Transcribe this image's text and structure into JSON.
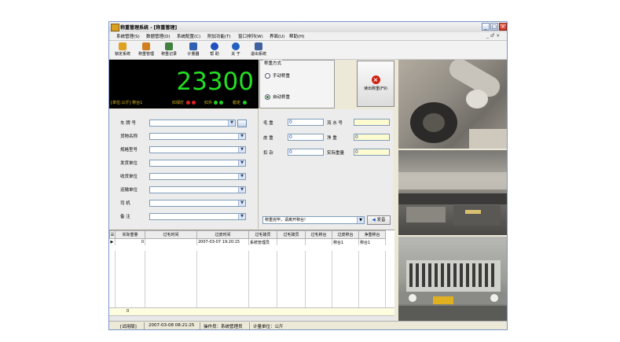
{
  "window": {
    "title": "称重管理系统 - [称重管理]",
    "controls": {
      "minimize": "_",
      "maximize": "□",
      "close": "×"
    }
  },
  "menu": {
    "items": [
      "系统管理(S)",
      "数据管理(D)",
      "系统配置(C)",
      "附加功能(T)",
      "窗口排列(W)",
      "界面(U)",
      "帮助(H)"
    ],
    "mdi_controls": "_ ♂ ×"
  },
  "toolbar": {
    "buttons": [
      {
        "label": "锁定系统",
        "icon": "lock-icon",
        "color": "#e0a020"
      },
      {
        "label": "称重管理",
        "icon": "scale-icon",
        "color": "#d08020"
      },
      {
        "label": "称重记录",
        "icon": "records-icon",
        "color": "#408040"
      },
      {
        "label": "计量器",
        "icon": "monitor-icon",
        "color": "#3060b0"
      },
      {
        "label": "帮 助",
        "icon": "help-icon",
        "color": "#2050c0"
      },
      {
        "label": "关 于",
        "icon": "about-icon",
        "color": "#2060c0"
      },
      {
        "label": "退出系统",
        "icon": "exit-icon",
        "color": "#4060a0"
      }
    ]
  },
  "weight": {
    "value": "23300",
    "color": "#22e022",
    "status": {
      "unit": "[单位:公斤] 称台1",
      "light": "红绿灯",
      "infrared": "红外",
      "stable": "稳定"
    }
  },
  "mode": {
    "title": "称重方式",
    "options": [
      {
        "label": "手动称重",
        "selected": false
      },
      {
        "label": "自动称重",
        "selected": true
      }
    ]
  },
  "zero_button": {
    "label": "读出称重(F9)"
  },
  "form_left": {
    "fields": [
      {
        "label": "车 牌 号",
        "value": ""
      },
      {
        "label": "货物名称",
        "value": ""
      },
      {
        "label": "规格型号",
        "value": ""
      },
      {
        "label": "发货单位",
        "value": ""
      },
      {
        "label": "收货单位",
        "value": ""
      },
      {
        "label": "运输单位",
        "value": ""
      },
      {
        "label": "司    机",
        "value": ""
      },
      {
        "label": "备    注",
        "value": ""
      }
    ]
  },
  "form_right": {
    "gross_label": "毛  重",
    "gross_value": "0",
    "serial_label": "流 水 号",
    "serial_value": "",
    "tare_label": "皮  重",
    "tare_value": "0",
    "net_label": "净  重",
    "net_value": "0",
    "deduct_label": "扣  杂",
    "deduct_value": "0",
    "actual_label": "实际重量",
    "actual_value": "0"
  },
  "hint": {
    "text": "称重完毕，请离开称台!",
    "send_label": "发音"
  },
  "grid": {
    "columns": [
      "实际重量",
      "过毛时间",
      "过皮时间",
      "过毛磅员",
      "过毛磅员",
      "过毛称台",
      "过皮称台",
      "净重称台"
    ],
    "rows": [
      [
        "0",
        "",
        "2007-03-07 19:20:15",
        "系统管理员",
        "",
        "",
        "称台1",
        "称台1"
      ]
    ],
    "summary_value": "0"
  },
  "statusbar": {
    "version": "[试用版]",
    "datetime": "2007-03-08 08:21:25",
    "operator": "操作员：系统管理员",
    "unit": "计量单位：公斤"
  }
}
